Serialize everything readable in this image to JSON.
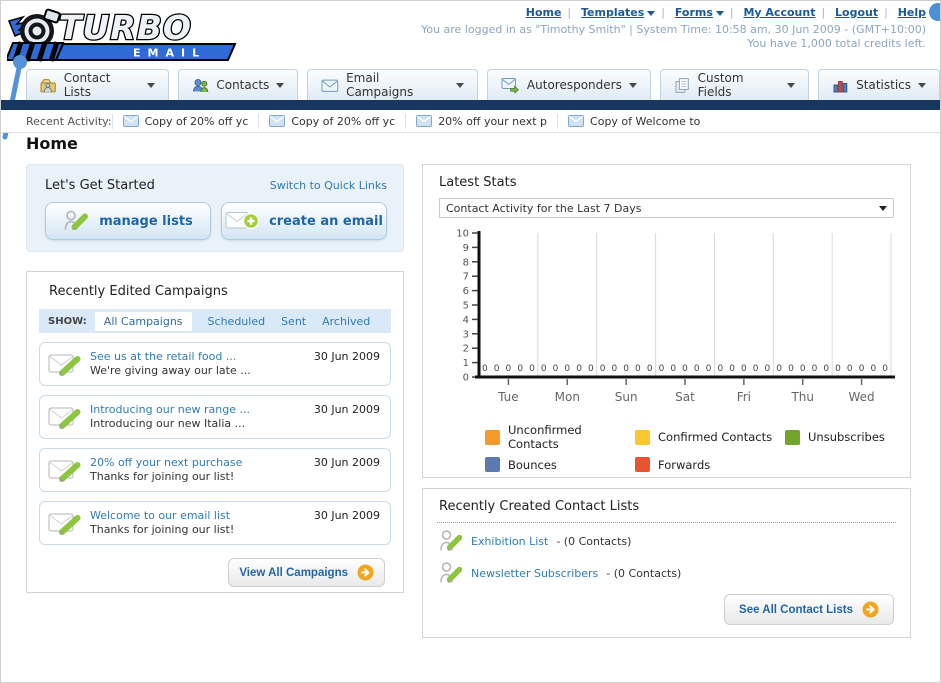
{
  "header": {
    "links": [
      {
        "label": "Home",
        "dropdown": false
      },
      {
        "label": "Templates",
        "dropdown": true
      },
      {
        "label": "Forms",
        "dropdown": true
      },
      {
        "label": "My Account",
        "dropdown": false
      },
      {
        "label": "Logout",
        "dropdown": false
      },
      {
        "label": "Help",
        "dropdown": false
      }
    ],
    "login_info": "You are logged in as \"Timothy Smith\" | System Time: 10:58 am, 30 Jun 2009 - (GMT+10:00)",
    "credits": "You have 1,000 total credits left.",
    "logo_title": "TURBO",
    "logo_subtitle": "EMAIL"
  },
  "nav": {
    "tabs": [
      {
        "label": "Contact Lists",
        "icon": "folder-contacts-icon"
      },
      {
        "label": "Contacts",
        "icon": "people-icon"
      },
      {
        "label": "Email Campaigns",
        "icon": "envelope-icon"
      },
      {
        "label": "Autoresponders",
        "icon": "envelope-arrow-icon"
      },
      {
        "label": "Custom Fields",
        "icon": "pages-icon"
      },
      {
        "label": "Statistics",
        "icon": "bar-chart-icon"
      }
    ]
  },
  "recent_activity": {
    "label": "Recent Activity:",
    "items": [
      "Copy of 20% off yc",
      "Copy of 20% off yc",
      "20% off your next p",
      "Copy of Welcome to"
    ]
  },
  "page_title": "Home",
  "get_started": {
    "title": "Let's Get Started",
    "switch_link": "Switch to Quick Links",
    "buttons": [
      {
        "label": "manage lists",
        "icon": "person-pencil-icon"
      },
      {
        "label": "create an email",
        "icon": "envelope-plus-icon"
      }
    ]
  },
  "campaigns": {
    "title": "Recently Edited Campaigns",
    "show_label": "SHOW:",
    "active_filter": "All Campaigns",
    "filters": [
      "Scheduled",
      "Sent",
      "Archived"
    ],
    "items": [
      {
        "title": "See us at the retail food ...",
        "subtitle": "We're giving away our late ...",
        "date": "30 Jun 2009"
      },
      {
        "title": "Introducing our new range ...",
        "subtitle": "Introducing our new Italia ...",
        "date": "30 Jun 2009"
      },
      {
        "title": "20% off your next purchase",
        "subtitle": "Thanks for joining our list!",
        "date": "30 Jun 2009"
      },
      {
        "title": "Welcome to our email list",
        "subtitle": "Thanks for joining our list!",
        "date": "30 Jun 2009"
      }
    ],
    "view_all_label": "View All Campaigns"
  },
  "stats": {
    "title": "Latest Stats",
    "selected_option": "Contact Activity for the Last 7 Days"
  },
  "chart_data": {
    "type": "bar",
    "title": "Contact Activity for the Last 7 Days",
    "categories": [
      "Tue",
      "Mon",
      "Sun",
      "Sat",
      "Fri",
      "Thu",
      "Wed"
    ],
    "series": [
      {
        "name": "Unconfirmed Contacts",
        "color": "#f49a2d",
        "values": [
          0,
          0,
          0,
          0,
          0,
          0,
          0
        ]
      },
      {
        "name": "Confirmed Contacts",
        "color": "#fcc62f",
        "values": [
          0,
          0,
          0,
          0,
          0,
          0,
          0
        ]
      },
      {
        "name": "Unsubscribes",
        "color": "#74a32b",
        "values": [
          0,
          0,
          0,
          0,
          0,
          0,
          0
        ]
      },
      {
        "name": "Bounces",
        "color": "#5c79b0",
        "values": [
          0,
          0,
          0,
          0,
          0,
          0,
          0
        ]
      },
      {
        "name": "Forwards",
        "color": "#e95430",
        "values": [
          0,
          0,
          0,
          0,
          0,
          0,
          0
        ]
      }
    ],
    "ylim": [
      0,
      10
    ],
    "yticks": [
      0,
      1,
      2,
      3,
      4,
      5,
      6,
      7,
      8,
      9,
      10
    ],
    "grid": "vertical-only",
    "legend_position": "bottom",
    "value_labels_shown": true
  },
  "contact_lists": {
    "title": "Recently Created Contact Lists",
    "items": [
      {
        "name": "Exhibition List",
        "detail": "- (0 Contacts)"
      },
      {
        "name": "Newsletter Subscribers",
        "detail": "- (0 Contacts)"
      }
    ],
    "see_all_label": "See All Contact Lists"
  }
}
